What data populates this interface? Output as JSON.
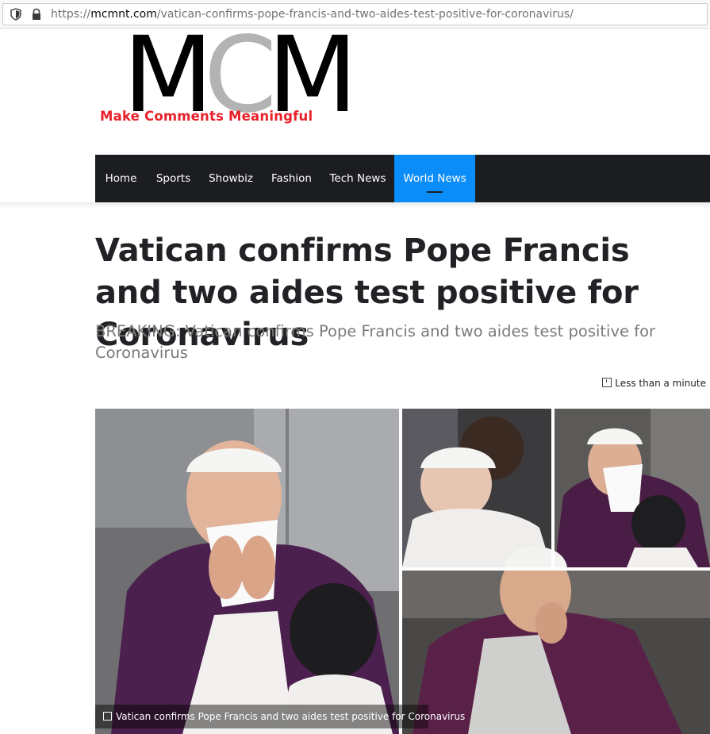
{
  "browser": {
    "url_prefix": "https://",
    "url_host": "mcmnt.com",
    "url_path": "/vatican-confirms-pope-francis-and-two-aides-test-positive-for-coronavirus/"
  },
  "logo": {
    "letter1": "M",
    "letter2": "C",
    "letter3": "M",
    "tagline": "Make Comments Meaningful",
    "colors": {
      "main": "#000000",
      "accent": "#b3b3b3",
      "tagline": "#e8202a"
    }
  },
  "nav": {
    "items": [
      {
        "label": "Home"
      },
      {
        "label": "Sports"
      },
      {
        "label": "Showbiz"
      },
      {
        "label": "Fashion"
      },
      {
        "label": "Tech News"
      },
      {
        "label": "World News",
        "active": true
      }
    ],
    "colors": {
      "background": "#1c1d21",
      "active": "#0a8cf9"
    }
  },
  "article": {
    "title": "Vatican confirms Pope Francis and two aides test positive for Coronavirus",
    "subtitle": "BREAKING: Vatican confirms Pope Francis and two aides test positive for Coronavirus",
    "read_time": "Less than a minute",
    "image_caption": "Vatican confirms Pope Francis and two aides test positive for Coronavirus"
  },
  "icons": [
    "shield-icon",
    "lock-icon",
    "clock-icon",
    "caption-icon"
  ]
}
